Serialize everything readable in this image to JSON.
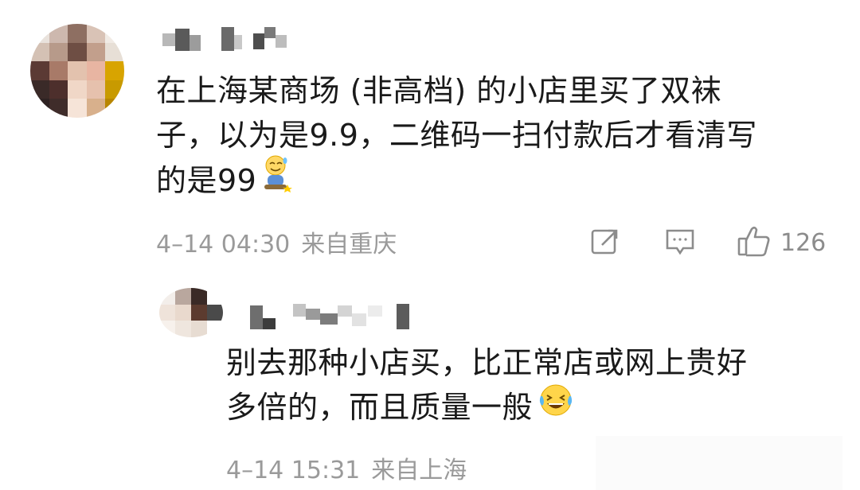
{
  "comment": {
    "text_lines": [
      "在上海某商场 (非高档) 的小店里买了双袜",
      "子，以为是9.9，二维码一扫付款后才看清写",
      "的是99"
    ],
    "emoji": "smile-sweat-emoji",
    "time": "4–14 04:30",
    "location": "来自重庆",
    "likes": "126",
    "icons": {
      "share": "share-icon",
      "comment": "comment-icon",
      "like": "thumbs-up-icon"
    }
  },
  "reply": {
    "text_lines": [
      "别去那种小店买，比正常店或网上贵好",
      "多倍的，而且质量一般"
    ],
    "emoji": "laughing-crying-emoji",
    "time": "4–14 15:31",
    "location": "来自上海"
  },
  "colors": {
    "text": "#1a1a1a",
    "meta": "#9a9a9a",
    "icon": "#8c8c8c",
    "background": "#ffffff"
  }
}
